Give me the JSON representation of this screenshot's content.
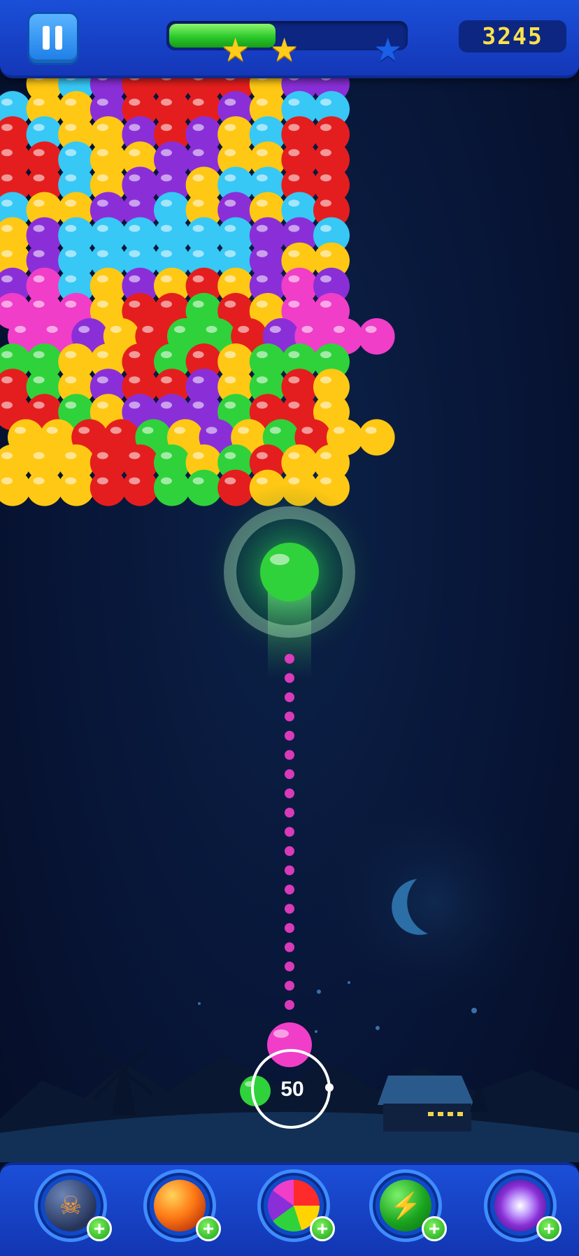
{
  "topbar": {
    "pause_icon": "pause-icon",
    "progress": 0.45,
    "stars": [
      {
        "state": "earned",
        "color": "#ffcc1a"
      },
      {
        "state": "earned",
        "color": "#ffcc1a"
      },
      {
        "state": "locked",
        "color": "#1a5fe8"
      }
    ],
    "score": "3245"
  },
  "shooter": {
    "current_bubble": "magenta",
    "next_bubble": "green",
    "bubbles_left": "50",
    "aim_target_bubble": "green"
  },
  "board": {
    "colors": {
      "Y": "#ffc814",
      "B": "#37c8f5",
      "P": "#8a2fd8",
      "R": "#e41e1e",
      "M": "#f03ec8",
      "G": "#2fd23a"
    },
    "rows": [
      "YBPRRRRYPP",
      "BYYPRRRPYBB",
      "RBYYPRPYBRR",
      "RRBYYPPYYRR",
      "RRBYPPYBBRR",
      "BYYPPBYPYBR",
      "YPBBBBBBPPB",
      "YPBBBBBBPYY",
      "PMBYPYRYPMP",
      "MMMYRRGRYMM",
      "MMPYRGGRPMMM",
      "GGYYRGRYGGG",
      "RGYPRRPYGRY",
      "RRGYPPPGRRY",
      "YYRRGYPYGRYY",
      "YYYRRGYGRYY",
      "YYYRRGGRYYY"
    ]
  },
  "boosters": [
    {
      "name": "bomb",
      "icon": "skull-bomb-icon"
    },
    {
      "name": "fireball",
      "icon": "fireball-icon"
    },
    {
      "name": "rainbow",
      "icon": "rainbow-ball-icon"
    },
    {
      "name": "lightning",
      "icon": "lightning-ball-icon"
    },
    {
      "name": "burst",
      "icon": "energy-burst-icon"
    }
  ]
}
